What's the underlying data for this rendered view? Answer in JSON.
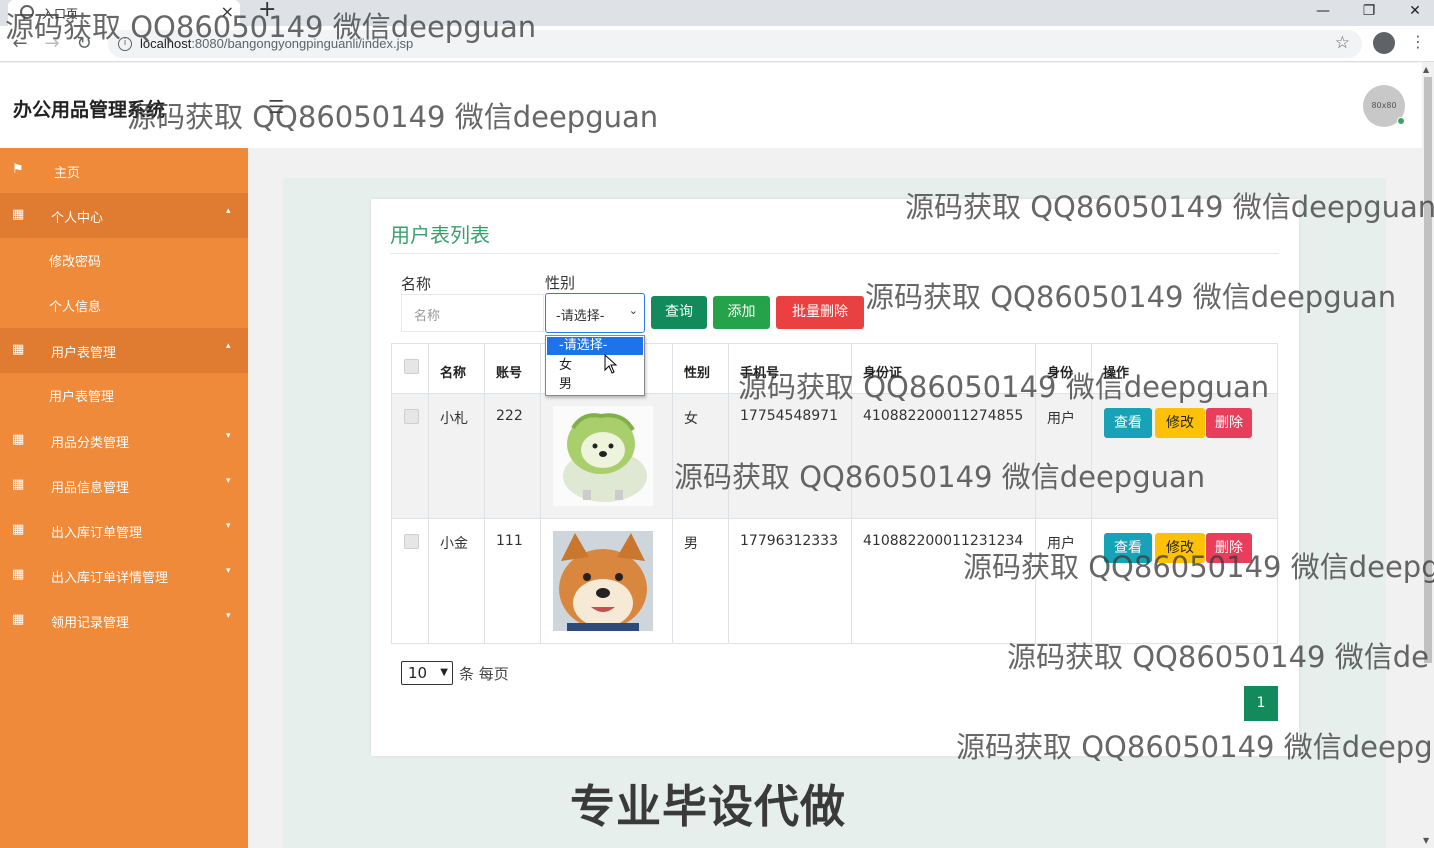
{
  "browser": {
    "tab_title": "入口页",
    "url_host": "localhost",
    "url_rest": ":8080/bangongyongpinguanli/index.jsp"
  },
  "header": {
    "app_title": "办公用品管理系统",
    "avatar_text": "80x80"
  },
  "sidebar": {
    "items": [
      {
        "label": "主页",
        "icon": "flag-icon"
      },
      {
        "label": "个人中心",
        "icon": "grid-icon"
      },
      {
        "label": "修改密码"
      },
      {
        "label": "个人信息"
      },
      {
        "label": "用户表管理",
        "icon": "grid-icon"
      },
      {
        "label": "用户表管理"
      },
      {
        "label": "用品分类管理",
        "icon": "grid-icon"
      },
      {
        "label": "用品信息管理",
        "icon": "grid-icon"
      },
      {
        "label": "出入库订单管理",
        "icon": "grid-icon"
      },
      {
        "label": "出入库订单详情管理",
        "icon": "grid-icon"
      },
      {
        "label": "领用记录管理",
        "icon": "grid-icon"
      }
    ]
  },
  "main": {
    "card_title": "用户表列表",
    "search": {
      "name_label": "名称",
      "name_placeholder": "名称",
      "sex_label": "性别",
      "sex_value": "-请选择-",
      "sex_options": [
        "-请选择-",
        "女",
        "男"
      ]
    },
    "buttons": {
      "query": "查询",
      "add": "添加",
      "batch_delete": "批量删除"
    },
    "table": {
      "headers": [
        "名称",
        "账号",
        "头像",
        "性别",
        "手机号",
        "身份证",
        "身份",
        "操作"
      ],
      "rows": [
        {
          "name": "小札",
          "account": "222",
          "sex": "女",
          "phone": "17754548971",
          "id_card": "410882200011274855",
          "role": "用户",
          "avatar": "cabbage-dog-image"
        },
        {
          "name": "小金",
          "account": "111",
          "sex": "男",
          "phone": "17796312333",
          "id_card": "410882200011231234",
          "role": "用户",
          "avatar": "shiba-dog-image"
        }
      ],
      "actions": {
        "view": "查看",
        "edit": "修改",
        "delete": "删除"
      }
    },
    "pagination": {
      "page_size": "10",
      "per_page_text": "条 每页",
      "current_page": "1"
    }
  },
  "overlay": {
    "watermark": "源码获取 QQ86050149 微信deepguan",
    "watermark_cut_1": "源码获取 QQ86050149 微信deepguan",
    "watermark_cut_2": "源码获取 QQ86050149 微信deepg",
    "watermark_cut_3": "源码获取 QQ86050149 微信de",
    "banner": "专业毕设代做"
  }
}
